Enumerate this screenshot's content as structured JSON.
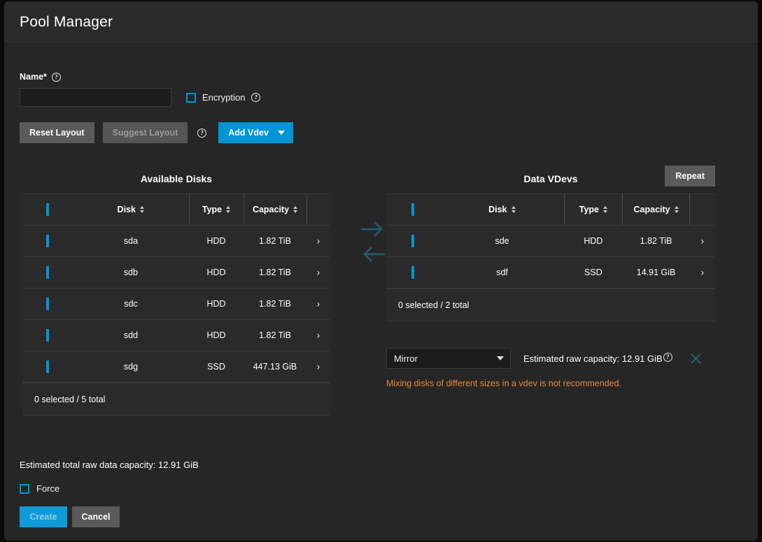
{
  "window": {
    "title": "Pool Manager"
  },
  "form": {
    "name_label": "Name*",
    "name_value": "",
    "name_placeholder": "",
    "encryption_label": "Encryption",
    "reset_layout_label": "Reset Layout",
    "suggest_layout_label": "Suggest Layout",
    "add_vdev_label": "Add Vdev",
    "help_glyph": "?"
  },
  "available": {
    "title": "Available Disks",
    "columns": [
      "Disk",
      "Type",
      "Capacity"
    ],
    "rows": [
      {
        "disk": "sda",
        "type": "HDD",
        "capacity": "1.82 TiB"
      },
      {
        "disk": "sdb",
        "type": "HDD",
        "capacity": "1.82 TiB"
      },
      {
        "disk": "sdc",
        "type": "HDD",
        "capacity": "1.82 TiB"
      },
      {
        "disk": "sdd",
        "type": "HDD",
        "capacity": "1.82 TiB"
      },
      {
        "disk": "sdg",
        "type": "SSD",
        "capacity": "447.13 GiB"
      }
    ],
    "footer": "0 selected / 5 total",
    "chevron": "›"
  },
  "vdevs": {
    "title": "Data VDevs",
    "repeat_label": "Repeat",
    "columns": [
      "Disk",
      "Type",
      "Capacity"
    ],
    "rows": [
      {
        "disk": "sde",
        "type": "HDD",
        "capacity": "1.82 TiB"
      },
      {
        "disk": "sdf",
        "type": "SSD",
        "capacity": "14.91 GiB"
      }
    ],
    "footer": "0 selected / 2 total",
    "chevron": "›",
    "layout_selected": "Mirror",
    "estimated_raw_capacity": "Estimated raw capacity: 12.91 GiB",
    "warning": "Mixing disks of different sizes in a vdev is not recommended."
  },
  "bottom": {
    "estimated_total": "Estimated total raw data capacity: 12.91 GiB",
    "force_label": "Force",
    "create_label": "Create",
    "cancel_label": "Cancel"
  },
  "colors": {
    "accent": "#0095d5",
    "warning": "#e8863a",
    "panel": "#2a2a2a",
    "background": "#262626",
    "disabled_arrow": "#265a6b"
  }
}
